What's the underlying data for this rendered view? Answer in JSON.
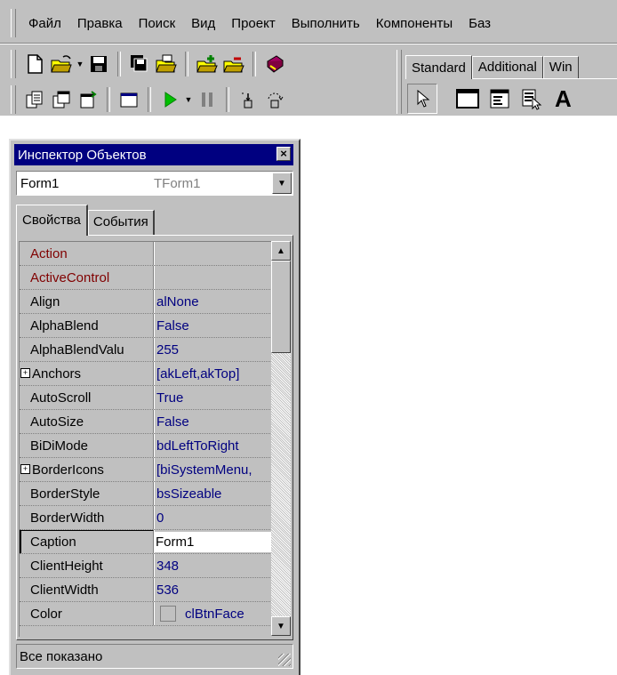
{
  "menu": {
    "items": [
      "Файл",
      "Правка",
      "Поиск",
      "Вид",
      "Проект",
      "Выполнить",
      "Компоненты",
      "Баз"
    ]
  },
  "toolbar": {
    "row1_icons": [
      "new-icon",
      "open-icon",
      "save-icon",
      "save-all-icon",
      "open-project-icon",
      "add-to-project-icon",
      "remove-from-project-icon",
      "help-icon"
    ],
    "row2_icons": [
      "view-unit-icon",
      "view-form-icon",
      "toggle-form-unit-icon",
      "new-form-icon",
      "run-icon",
      "pause-icon",
      "trace-into-icon",
      "step-over-icon"
    ]
  },
  "palette": {
    "tabs": [
      "Standard",
      "Additional",
      "Win"
    ],
    "active_tab": "Standard",
    "first_partial_letter": "A"
  },
  "inspector": {
    "title": "Инспектор Объектов",
    "close_glyph": "×",
    "selected_object": "Form1",
    "selected_type": "TForm1",
    "tabs": [
      "Свойства",
      "События"
    ],
    "active_tab": "Свойства",
    "properties": [
      {
        "name": "Action",
        "value": "",
        "kind": "event"
      },
      {
        "name": "ActiveControl",
        "value": "",
        "kind": "event"
      },
      {
        "name": "Align",
        "value": "alNone"
      },
      {
        "name": "AlphaBlend",
        "value": "False"
      },
      {
        "name": "AlphaBlendValu",
        "value": "255"
      },
      {
        "name": "Anchors",
        "value": "[akLeft,akTop]",
        "expander": "+"
      },
      {
        "name": "AutoScroll",
        "value": "True"
      },
      {
        "name": "AutoSize",
        "value": "False"
      },
      {
        "name": "BiDiMode",
        "value": "bdLeftToRight"
      },
      {
        "name": "BorderIcons",
        "value": "[biSystemMenu,",
        "expander": "+"
      },
      {
        "name": "BorderStyle",
        "value": "bsSizeable"
      },
      {
        "name": "BorderWidth",
        "value": "0"
      },
      {
        "name": "Caption",
        "value": "Form1",
        "selected": true
      },
      {
        "name": "ClientHeight",
        "value": "348"
      },
      {
        "name": "ClientWidth",
        "value": "536"
      },
      {
        "name": "Color",
        "value": "clBtnFace",
        "swatch": "#c0c0c0"
      }
    ],
    "status": "Все показано"
  },
  "colors": {
    "titlebar": "#000080",
    "face": "#c0c0c0",
    "value_text": "#000080",
    "event_text": "#800000"
  }
}
